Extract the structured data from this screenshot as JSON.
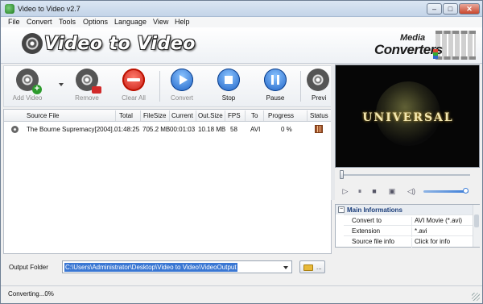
{
  "window": {
    "title": "Video to Video v2.7"
  },
  "menu": [
    "File",
    "Convert",
    "Tools",
    "Options",
    "Language",
    "View",
    "Help"
  ],
  "banner": {
    "title": "Video to Video",
    "logo_line1": "Media",
    "logo_line2": "Converters"
  },
  "toolbar": {
    "add_video": "Add Video",
    "remove": "Remove",
    "clear_all": "Clear All",
    "convert": "Convert",
    "stop": "Stop",
    "pause": "Pause",
    "preview": "Previ"
  },
  "grid": {
    "headers": [
      "Source File",
      "Total",
      "FileSize",
      "Current",
      "Out.Size",
      "FPS",
      "To",
      "Progress",
      "Status"
    ],
    "rows": [
      {
        "source": "The Bourne Supremacy[2004]...",
        "total": "01:48:25",
        "filesize": "705.2 MB",
        "current": "00:01:03",
        "outsize": "10.18 MB",
        "fps": "58",
        "to": "AVI",
        "progress": "0 %"
      }
    ]
  },
  "output": {
    "label": "Output Folder",
    "path": "C:\\Users\\Administrator\\Desktop\\Video to Video\\VideoOutput",
    "browse": "..."
  },
  "preview": {
    "logo_text": "UNIVERSAL"
  },
  "info": {
    "title": "Main Informations",
    "rows": [
      {
        "key": "Convert to",
        "value": "AVI Movie (*.avi)"
      },
      {
        "key": "Extension",
        "value": "*.avi"
      },
      {
        "key": "Source file info",
        "value": "Click for info"
      }
    ]
  },
  "status": {
    "text": "Converting...0%"
  },
  "colors": {
    "accent": "#3a77d3",
    "title_bar": "#c3d4e8",
    "clear_red": "#c4160e",
    "button_blue": "#1a5fc4"
  }
}
